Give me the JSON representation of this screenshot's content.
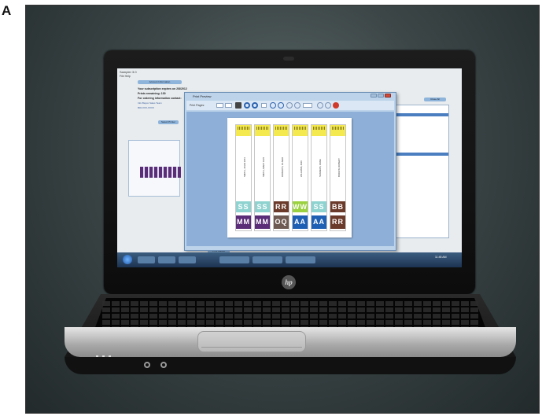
{
  "panel_label": "A",
  "laptop": {
    "brand_logo": "hp"
  },
  "app": {
    "title": "Sampler 3.0",
    "menu": "File   Help"
  },
  "background_window": {
    "header_button": "Account Information",
    "lines": [
      "Your subscription expires on 2/8/2012",
      "Prints remaining: 100",
      "For ordering information contact:"
    ],
    "contact_lines": [
      "Info Bayco Sales Team",
      "800-XXX-XXXX"
    ],
    "secondary_button": "Select Printer",
    "bottom_button": "Print Labels",
    "right_button": "Close All"
  },
  "dialog": {
    "title": "Print Preview",
    "toolbar_label": "Print Pages:",
    "colors": {
      "header_yellow": "#f4ea4f",
      "light_teal": "#8fd3d0",
      "brown": "#6b3a2a",
      "lime": "#9ad13e",
      "purple": "#5b2d78",
      "blue": "#1e5fb4",
      "grey_brown": "#6e5a52"
    },
    "labels": [
      {
        "text": "SMITH, JOHN  1974",
        "code1": "SS",
        "code1_color": "#8fd3d0",
        "code2": "MM",
        "code2_color": "#5b2d78"
      },
      {
        "text": "SMITH, MARY  1976",
        "code1": "SS",
        "code1_color": "#8fd3d0",
        "code2": "MM",
        "code2_color": "#5b2d78"
      },
      {
        "text": "ROBERTS, OLIVER",
        "code1": "RR",
        "code1_color": "#6b3a2a",
        "code2": "OQ",
        "code2_color": "#6e5a52"
      },
      {
        "text": "WILLIAMS, ANN",
        "code1": "WW",
        "code1_color": "#9ad13e",
        "code2": "AA",
        "code2_color": "#1e5fb4"
      },
      {
        "text": "SANDERS, ANNE",
        "code1": "SS",
        "code1_color": "#8fd3d0",
        "code2": "AA",
        "code2_color": "#1e5fb4"
      },
      {
        "text": "BROWN, ROBERT",
        "code1": "BB",
        "code1_color": "#6b3a2a",
        "code2": "RR",
        "code2_color": "#6b3a2a"
      }
    ]
  },
  "taskbar": {
    "clock": "11:45 AM"
  }
}
